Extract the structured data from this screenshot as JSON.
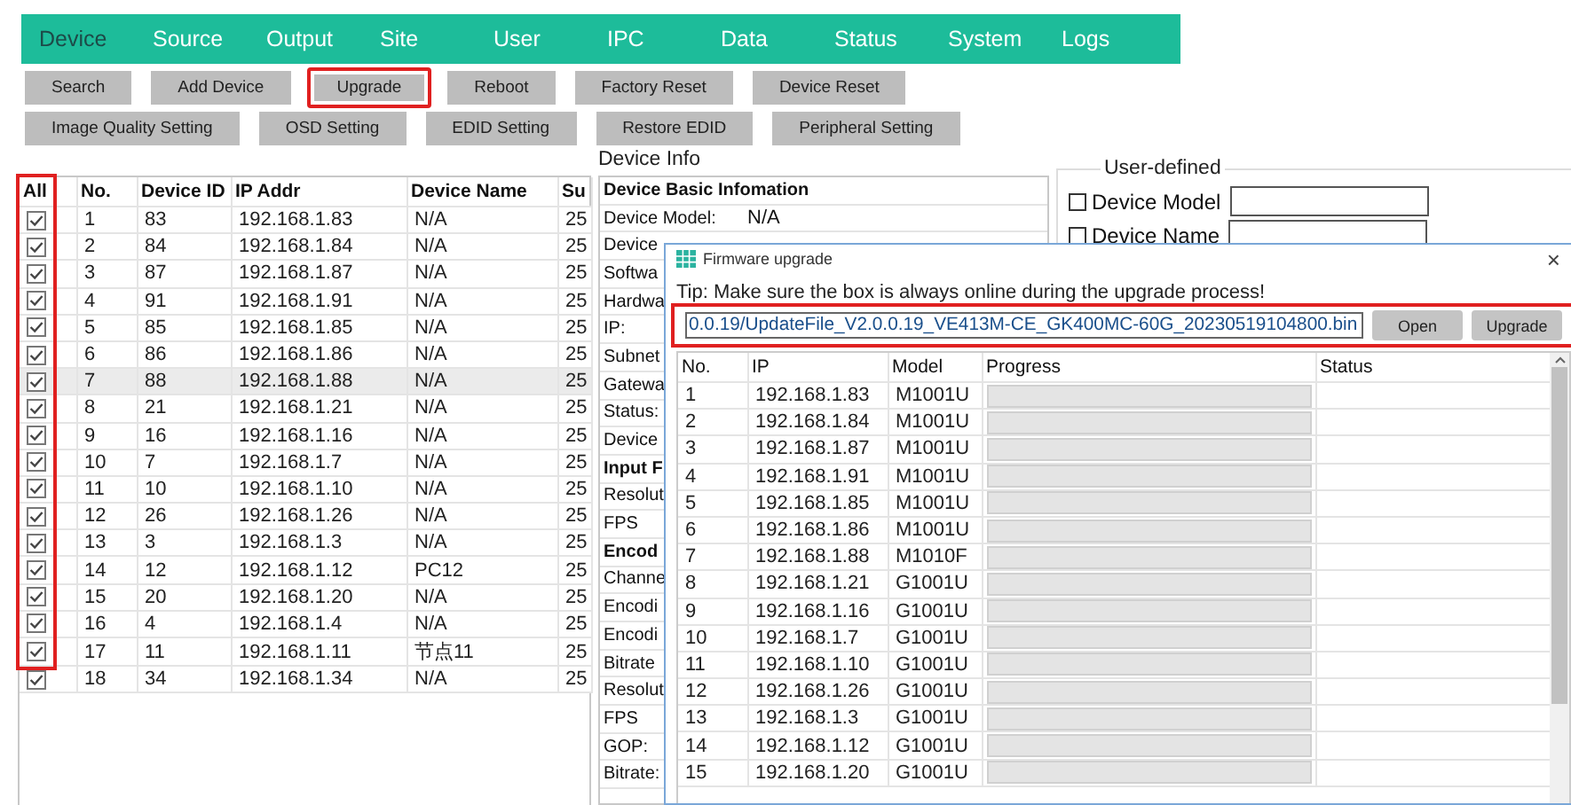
{
  "nav": {
    "items": [
      {
        "label": "Device",
        "selected": true
      },
      {
        "label": "Source",
        "selected": false
      },
      {
        "label": "Output",
        "selected": false
      },
      {
        "label": "Site",
        "selected": false
      },
      {
        "label": "User",
        "selected": false
      },
      {
        "label": "IPC",
        "selected": false
      },
      {
        "label": "Data",
        "selected": false
      },
      {
        "label": "Status",
        "selected": false
      },
      {
        "label": "System",
        "selected": false
      },
      {
        "label": "Logs",
        "selected": false
      }
    ]
  },
  "toolbar_rows": [
    [
      {
        "label": "Search",
        "highlighted": false
      },
      {
        "label": "Add Device",
        "highlighted": false
      },
      {
        "label": "Upgrade",
        "highlighted": true
      },
      {
        "label": "Reboot",
        "highlighted": false
      },
      {
        "label": "Factory Reset",
        "highlighted": false
      },
      {
        "label": "Device Reset",
        "highlighted": false
      }
    ],
    [
      {
        "label": "Image Quality Setting",
        "highlighted": false
      },
      {
        "label": "OSD Setting",
        "highlighted": false
      },
      {
        "label": "EDID Setting",
        "highlighted": false
      },
      {
        "label": "Restore EDID",
        "highlighted": false
      },
      {
        "label": "Peripheral Setting",
        "highlighted": false
      }
    ]
  ],
  "device_table": {
    "check_column": "All",
    "check_column_highlighted": true,
    "columns": [
      "No.",
      "Device ID",
      "IP Addr",
      "Device Name",
      "Su"
    ],
    "rows": [
      {
        "checked": true,
        "selected": false,
        "cells": [
          "1",
          "83",
          "192.168.1.83",
          "N/A",
          "25"
        ]
      },
      {
        "checked": true,
        "selected": false,
        "cells": [
          "2",
          "84",
          "192.168.1.84",
          "N/A",
          "25"
        ]
      },
      {
        "checked": true,
        "selected": false,
        "cells": [
          "3",
          "87",
          "192.168.1.87",
          "N/A",
          "25"
        ]
      },
      {
        "checked": true,
        "selected": false,
        "cells": [
          "4",
          "91",
          "192.168.1.91",
          "N/A",
          "25"
        ]
      },
      {
        "checked": true,
        "selected": false,
        "cells": [
          "5",
          "85",
          "192.168.1.85",
          "N/A",
          "25"
        ]
      },
      {
        "checked": true,
        "selected": false,
        "cells": [
          "6",
          "86",
          "192.168.1.86",
          "N/A",
          "25"
        ]
      },
      {
        "checked": true,
        "selected": true,
        "cells": [
          "7",
          "88",
          "192.168.1.88",
          "N/A",
          "25"
        ]
      },
      {
        "checked": true,
        "selected": false,
        "cells": [
          "8",
          "21",
          "192.168.1.21",
          "N/A",
          "25"
        ]
      },
      {
        "checked": true,
        "selected": false,
        "cells": [
          "9",
          "16",
          "192.168.1.16",
          "N/A",
          "25"
        ]
      },
      {
        "checked": true,
        "selected": false,
        "cells": [
          "10",
          "7",
          "192.168.1.7",
          "N/A",
          "25"
        ]
      },
      {
        "checked": true,
        "selected": false,
        "cells": [
          "11",
          "10",
          "192.168.1.10",
          "N/A",
          "25"
        ]
      },
      {
        "checked": true,
        "selected": false,
        "cells": [
          "12",
          "26",
          "192.168.1.26",
          "N/A",
          "25"
        ]
      },
      {
        "checked": true,
        "selected": false,
        "cells": [
          "13",
          "3",
          "192.168.1.3",
          "N/A",
          "25"
        ]
      },
      {
        "checked": true,
        "selected": false,
        "cells": [
          "14",
          "12",
          "192.168.1.12",
          "PC12",
          "25"
        ]
      },
      {
        "checked": true,
        "selected": false,
        "cells": [
          "15",
          "20",
          "192.168.1.20",
          "N/A",
          "25"
        ]
      },
      {
        "checked": true,
        "selected": false,
        "cells": [
          "16",
          "4",
          "192.168.1.4",
          "N/A",
          "25"
        ]
      },
      {
        "checked": true,
        "selected": false,
        "cells": [
          "17",
          "11",
          "192.168.1.11",
          "节点11",
          "25"
        ]
      },
      {
        "checked": true,
        "selected": false,
        "cells": [
          "18",
          "34",
          "192.168.1.34",
          "N/A",
          "25"
        ]
      }
    ]
  },
  "device_info": {
    "title": "Device Info",
    "rows": [
      {
        "kind": "section",
        "label": "Device Basic Infomation"
      },
      {
        "kind": "field",
        "label": "Device Model:",
        "value": "N/A"
      },
      {
        "kind": "field",
        "label": "Device"
      },
      {
        "kind": "field",
        "label": "Softwa"
      },
      {
        "kind": "field",
        "label": "Hardwa"
      },
      {
        "kind": "field",
        "label": "IP:"
      },
      {
        "kind": "field",
        "label": "Subnet"
      },
      {
        "kind": "field",
        "label": "Gatewa"
      },
      {
        "kind": "field",
        "label": "Status:"
      },
      {
        "kind": "field",
        "label": "Device"
      },
      {
        "kind": "section",
        "label": "Input F"
      },
      {
        "kind": "field",
        "label": "Resolut"
      },
      {
        "kind": "field",
        "label": "FPS"
      },
      {
        "kind": "section",
        "label": "Encod"
      },
      {
        "kind": "field",
        "label": "Channe"
      },
      {
        "kind": "field",
        "label": "Encodi"
      },
      {
        "kind": "field",
        "label": "Encodi"
      },
      {
        "kind": "field",
        "label": "Bitrate"
      },
      {
        "kind": "field",
        "label": "Resolut"
      },
      {
        "kind": "field",
        "label": "FPS"
      },
      {
        "kind": "field",
        "label": "GOP:"
      },
      {
        "kind": "field",
        "label": "Bitrate:"
      }
    ]
  },
  "user_defined": {
    "title": "User-defined",
    "fields": [
      {
        "label": "Device Model",
        "checked": false
      },
      {
        "label": "Device Name",
        "checked": false
      }
    ]
  },
  "dialog": {
    "title": "Firmware upgrade",
    "close": "×",
    "tip": "Tip: Make sure the box is always online during the upgrade process!",
    "file_path": "0.0.19/UpdateFile_V2.0.0.19_VE413M-CE_GK400MC-60G_20230519104800.bin",
    "path_highlighted": true,
    "buttons": [
      "Open",
      "Upgrade"
    ],
    "table": {
      "columns": [
        "No.",
        "IP",
        "Model",
        "Progress",
        "Status"
      ],
      "rows": [
        {
          "cells": [
            "1",
            "192.168.1.83",
            "M1001U"
          ]
        },
        {
          "cells": [
            "2",
            "192.168.1.84",
            "M1001U"
          ]
        },
        {
          "cells": [
            "3",
            "192.168.1.87",
            "M1001U"
          ]
        },
        {
          "cells": [
            "4",
            "192.168.1.91",
            "M1001U"
          ]
        },
        {
          "cells": [
            "5",
            "192.168.1.85",
            "M1001U"
          ]
        },
        {
          "cells": [
            "6",
            "192.168.1.86",
            "M1001U"
          ]
        },
        {
          "cells": [
            "7",
            "192.168.1.88",
            "M1010F"
          ]
        },
        {
          "cells": [
            "8",
            "192.168.1.21",
            "G1001U"
          ]
        },
        {
          "cells": [
            "9",
            "192.168.1.16",
            "G1001U"
          ]
        },
        {
          "cells": [
            "10",
            "192.168.1.7",
            "G1001U"
          ]
        },
        {
          "cells": [
            "11",
            "192.168.1.10",
            "G1001U"
          ]
        },
        {
          "cells": [
            "12",
            "192.168.1.26",
            "G1001U"
          ]
        },
        {
          "cells": [
            "13",
            "192.168.1.3",
            "G1001U"
          ]
        },
        {
          "cells": [
            "14",
            "192.168.1.12",
            "G1001U"
          ]
        },
        {
          "cells": [
            "15",
            "192.168.1.20",
            "G1001U"
          ]
        }
      ]
    }
  }
}
